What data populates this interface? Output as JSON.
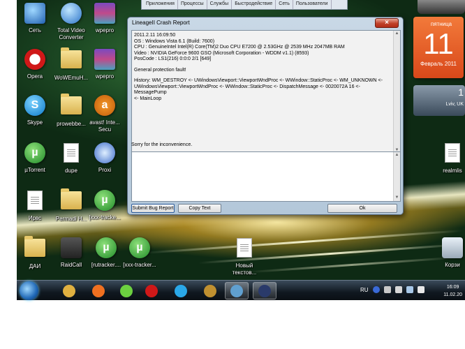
{
  "top_window": {
    "tabs": [
      "Приложения",
      "Процессы",
      "Службы",
      "Быстродействие",
      "Сеть",
      "Пользователи"
    ]
  },
  "dialog": {
    "title": "LineageII Crash Report",
    "report_lines": [
      "2011.2.11 16:09:50",
      "OS : Windows Vista 6.1 (Build: 7600)",
      "CPU : GenuineIntel  Intel(R) Core(TM)2 Duo CPU     E7200  @ 2.53GHz @ 2539 MHz 2047MB RAM",
      "Video : NVIDIA GeForce 9600 GSO (Microsoft Corporation - WDDM v1.1) (8593)",
      "PosCode : LS1(216) 0:0:0 2/1 [649]",
      "",
      "General protection fault!",
      "",
      "History: WM_DESTROY <- UWindowsViewport::ViewportWndProc <- WWindow::StaticProc <- WM_UNKNOWN <-",
      "UWindowsViewport::ViewportWndProc <- WWindow::StaticProc <- DispatchMessage <- 0020072A 16 <- MessagePump",
      "<- MainLoop"
    ],
    "sorry": "Sorry for the inconvenience.",
    "buttons": {
      "submit": "Submit Bug Report",
      "copy": "Copy Text",
      "ok": "Ok"
    }
  },
  "desktop_icons": [
    {
      "label": "Сеть",
      "kind": "net"
    },
    {
      "label": "Total Video Converter",
      "kind": "tvc"
    },
    {
      "label": "wpepro",
      "kind": "winrar"
    },
    {
      "label": "Opera",
      "kind": "opera"
    },
    {
      "label": "WoWEmuH...",
      "kind": "folder"
    },
    {
      "label": "wpepro",
      "kind": "winrar"
    },
    {
      "label": "Skype",
      "kind": "skype"
    },
    {
      "label": "prowebbe...",
      "kind": "folder"
    },
    {
      "label": "avast! Inte... Secu",
      "kind": "avast"
    },
    {
      "label": "µTorrent",
      "kind": "utorrent"
    },
    {
      "label": "dupe",
      "kind": "doc"
    },
    {
      "label": "Proxi",
      "kind": "proxi"
    },
    {
      "label": "Ирвс",
      "kind": "doc"
    },
    {
      "label": "Permadi H...",
      "kind": "folder"
    },
    {
      "label": "[xxx-tracke...",
      "kind": "utorrent"
    },
    {
      "label": "ДАИ",
      "kind": "folder"
    },
    {
      "label": "RaidCall",
      "kind": "raidcall"
    },
    {
      "label": "[rutracker....",
      "kind": "utorrent"
    },
    {
      "label": "[xxx-tracker...",
      "kind": "utorrent"
    },
    {
      "label": "Новый текстов...",
      "kind": "doc"
    },
    {
      "label": "realmlis",
      "kind": "doc"
    },
    {
      "label": "Корзи",
      "kind": "recycle"
    }
  ],
  "calendar": {
    "weekday": "пятница",
    "day": "11",
    "month_year": "Февраль 2011"
  },
  "weather": {
    "temp": "1",
    "city": "Lviv, UK"
  },
  "taskbar": {
    "apps": [
      {
        "name": "explorer",
        "color": "#e0b040"
      },
      {
        "name": "media-player",
        "color": "#f07020"
      },
      {
        "name": "icq",
        "color": "#6cd040"
      },
      {
        "name": "opera",
        "color": "#d01818"
      },
      {
        "name": "skype",
        "color": "#2aa8e8"
      },
      {
        "name": "warcraft",
        "color": "#c09030"
      },
      {
        "name": "task-manager",
        "color": "#60a0d0"
      },
      {
        "name": "lineage",
        "color": "#2a3a6a"
      }
    ],
    "lang": "RU",
    "time": "16:09",
    "date": "11.02.20"
  }
}
